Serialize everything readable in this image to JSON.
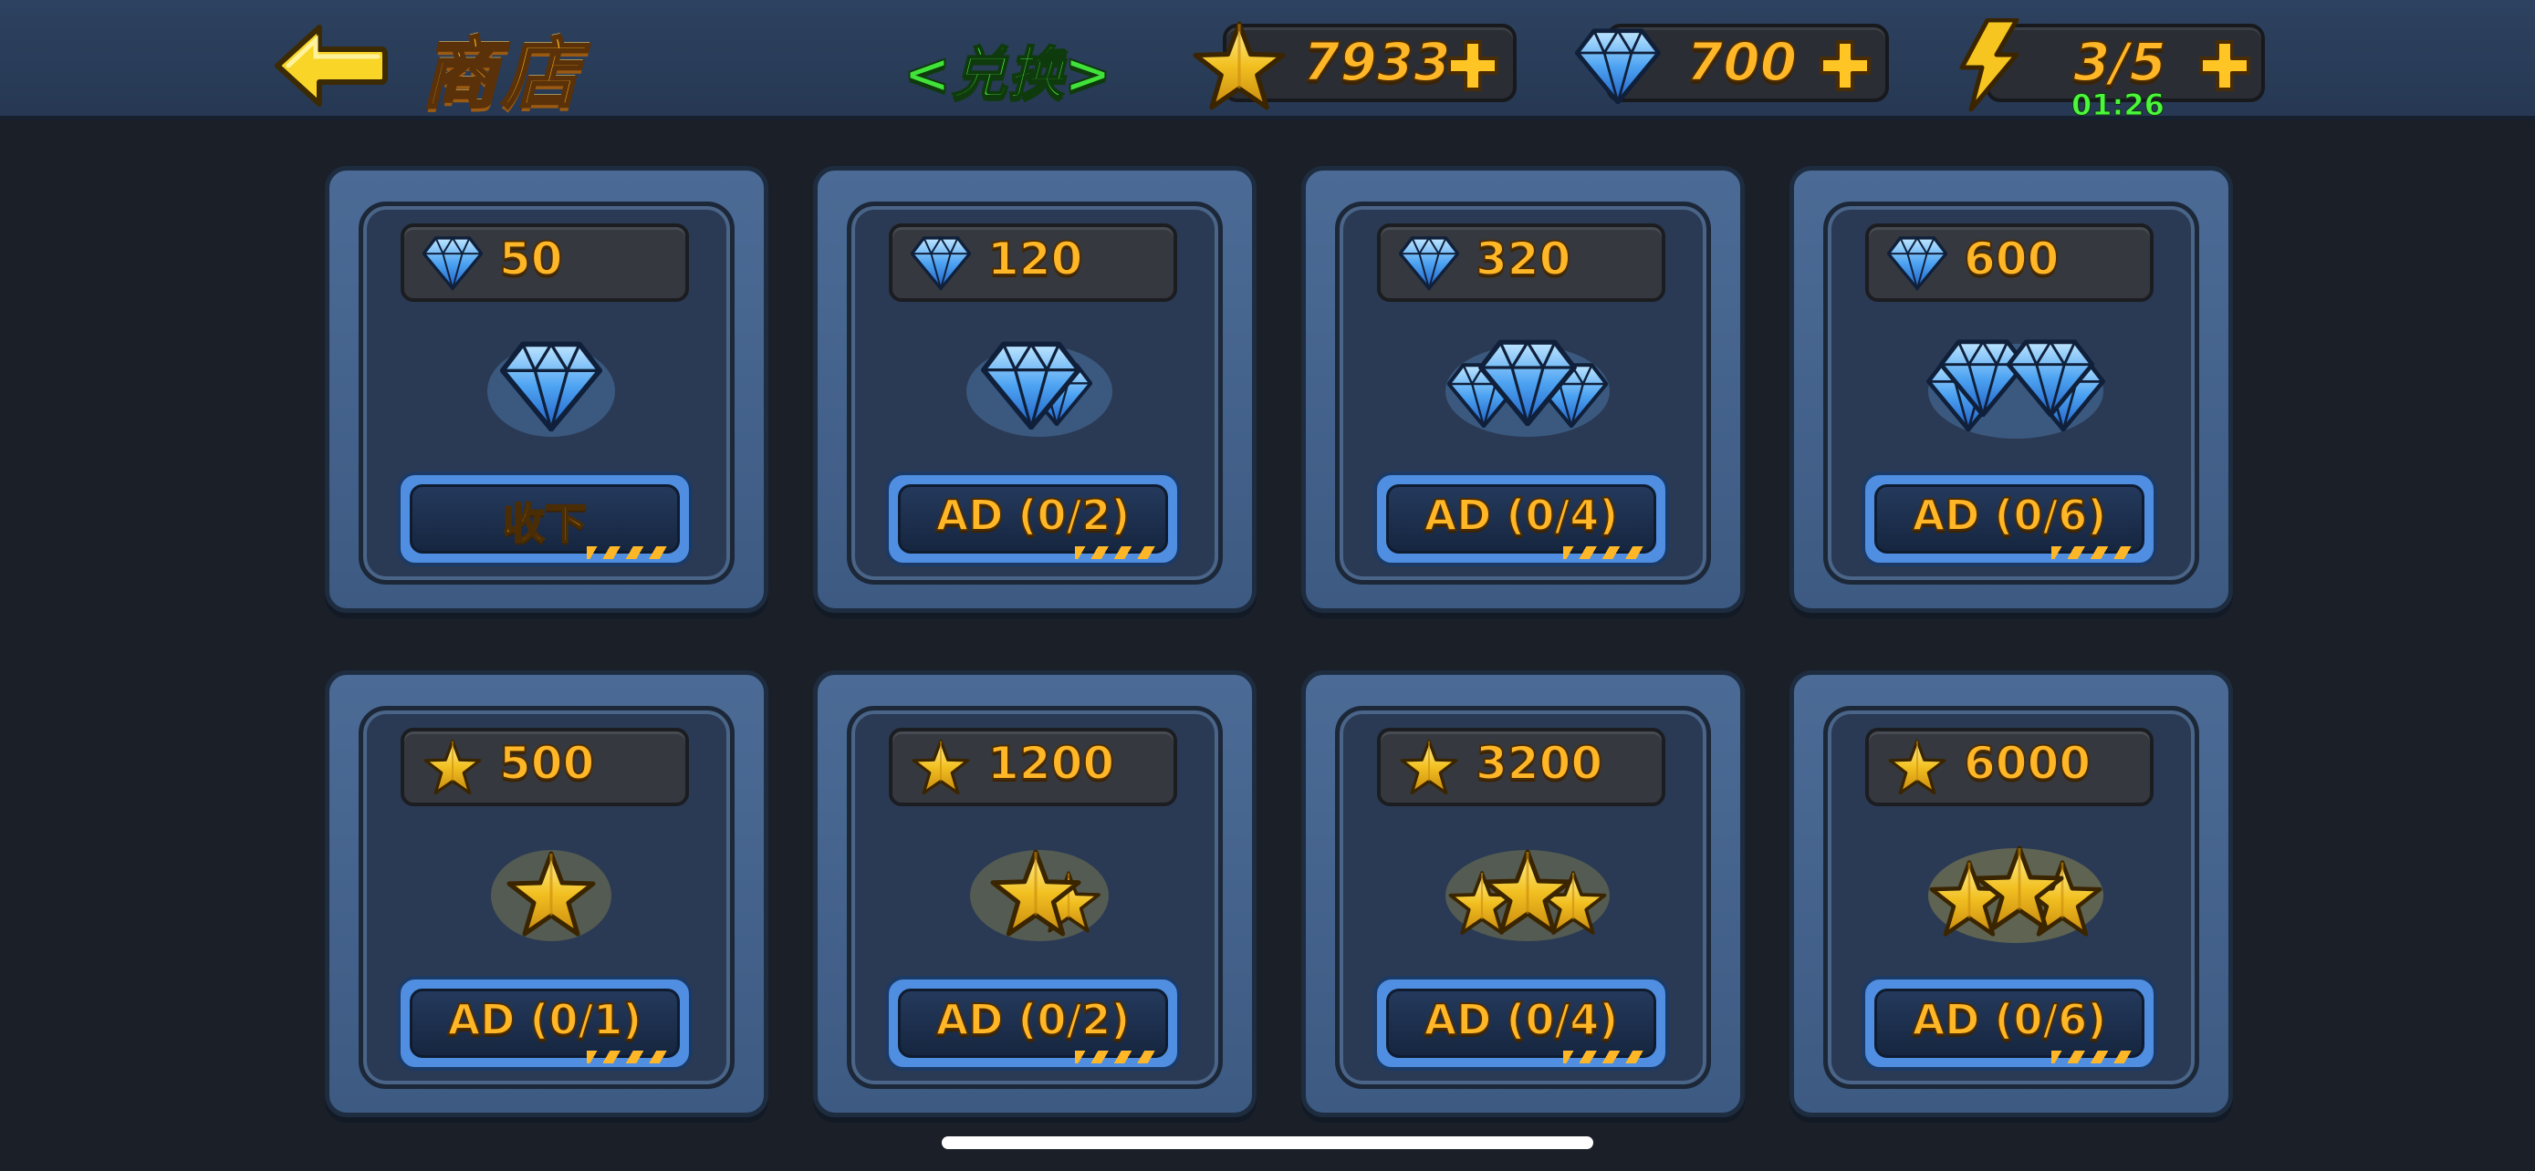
{
  "header": {
    "title": "商店",
    "tab_label": "<兑换>",
    "stars": "7933",
    "gems": "700",
    "energy": "3/5",
    "energy_timer": "01:26"
  },
  "colors": {
    "gold_text": "#ffb728",
    "green_text": "#41e23a",
    "card_blue": "#4b6b96"
  },
  "gem_cards": [
    {
      "price": "50",
      "button": "收下"
    },
    {
      "price": "120",
      "button": "AD (0/2)"
    },
    {
      "price": "320",
      "button": "AD (0/4)"
    },
    {
      "price": "600",
      "button": "AD (0/6)"
    }
  ],
  "star_cards": [
    {
      "price": "500",
      "button": "AD (0/1)"
    },
    {
      "price": "1200",
      "button": "AD (0/2)"
    },
    {
      "price": "3200",
      "button": "AD (0/4)"
    },
    {
      "price": "6000",
      "button": "AD (0/6)"
    }
  ],
  "icons": {
    "back": "arrow-left-icon",
    "star": "star-icon",
    "gem": "diamond-icon",
    "energy": "lightning-icon",
    "plus": "plus-icon"
  }
}
